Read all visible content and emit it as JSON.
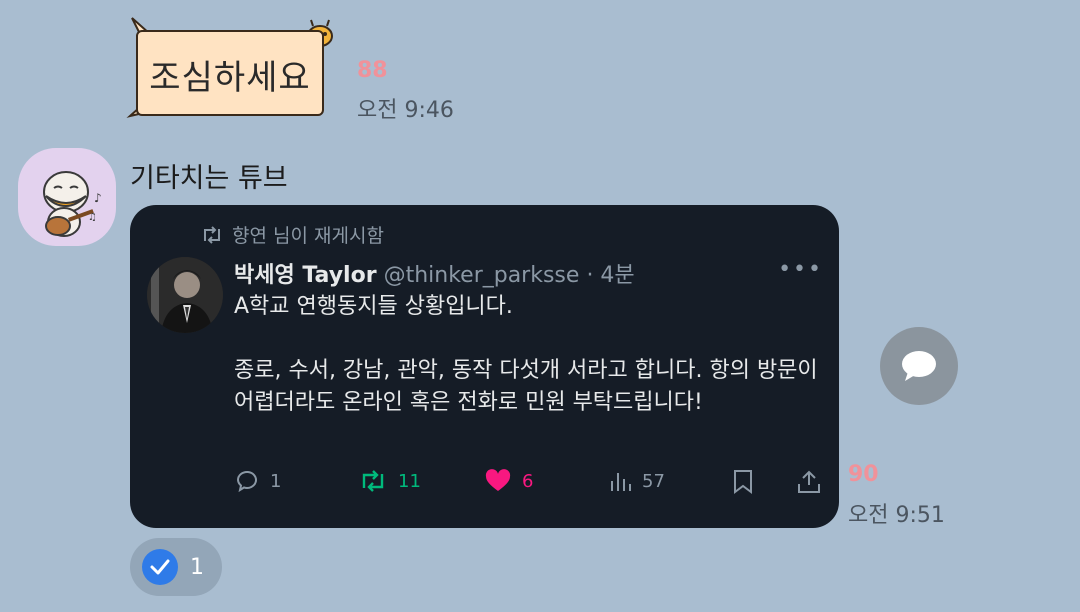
{
  "sticker_message": {
    "text": "조심하세요",
    "unread": "88",
    "time": "오전 9:46"
  },
  "sender": {
    "name": "기타치는 튜브"
  },
  "shared_post": {
    "repost_line": "향연 님이 재게시함",
    "author_name": "박세영 Taylor",
    "author_handle": "@thinker_parksse",
    "age": "· 4분",
    "paragraph1": "A학교 연행동지들 상황입니다.",
    "paragraph2": "종로, 수서, 강남, 관악, 동작 다섯개 서라고 합니다. 항의 방문이 어렵더라도 온라인 혹은 전화로 민원 부탁드립니다!",
    "replies": "1",
    "reposts": "11",
    "likes": "6",
    "views": "57",
    "repost_color": "#00ba7c",
    "like_color": "#f91880"
  },
  "post_message": {
    "unread": "90",
    "time": "오전 9:51"
  },
  "reaction": {
    "count": "1",
    "icon": "check-icon"
  }
}
